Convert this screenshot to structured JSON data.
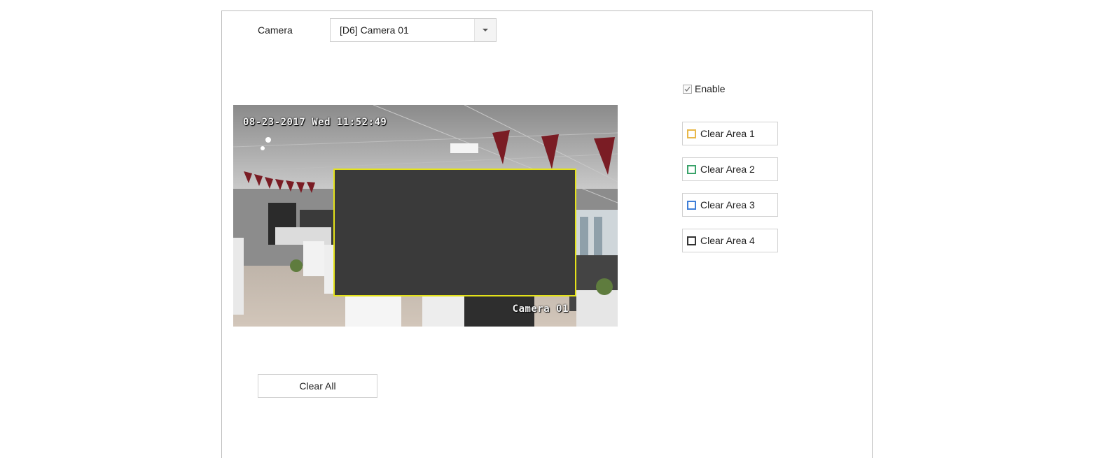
{
  "camera": {
    "label": "Camera",
    "selected": "[D6] Camera 01",
    "dropdown_icon": "caret-down-icon"
  },
  "video": {
    "osd_datetime": "08-23-2017 Wed 11:52:49",
    "osd_camera_name": "Camera 01",
    "active_area_color": "#e4e21a"
  },
  "enable": {
    "label": "Enable",
    "checked": true
  },
  "areas": [
    {
      "label": "Clear Area 1",
      "color": "#e8b84a"
    },
    {
      "label": "Clear Area 2",
      "color": "#3aa36a"
    },
    {
      "label": "Clear Area 3",
      "color": "#3f7fd8"
    },
    {
      "label": "Clear Area 4",
      "color": "#333333"
    }
  ],
  "clear_all_label": "Clear All"
}
